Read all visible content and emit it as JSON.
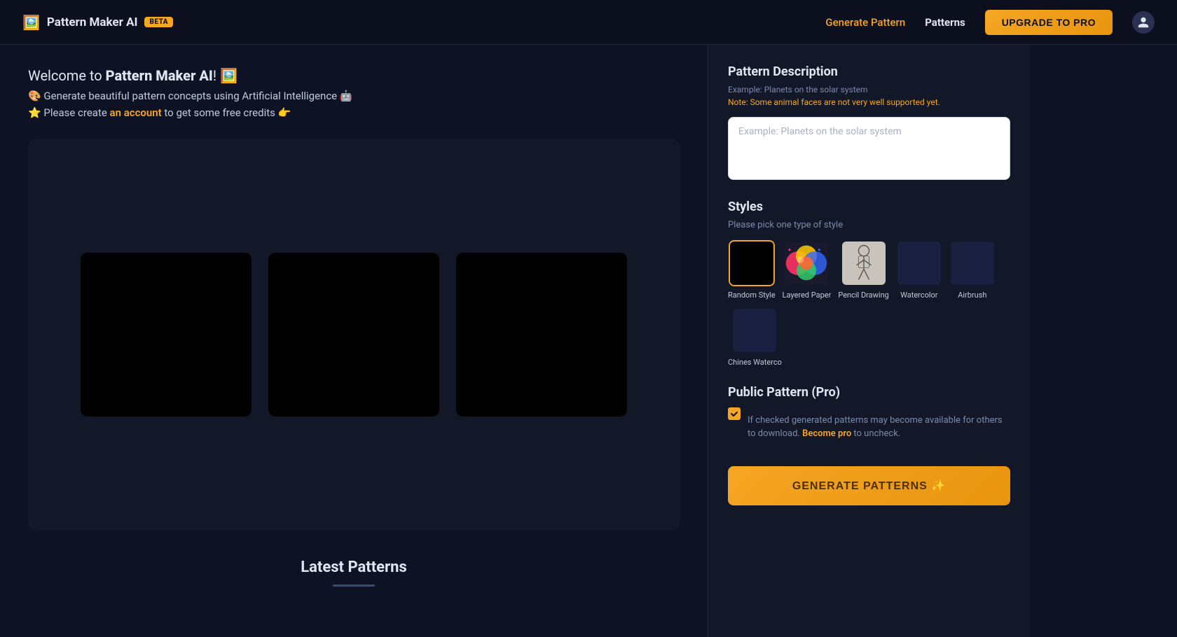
{
  "header": {
    "logo_emoji": "🖼️",
    "logo_title": "Pattern Maker AI",
    "beta_label": "BETA",
    "nav_generate": "Generate Pattern",
    "nav_patterns": "Patterns",
    "upgrade_label": "UPGRADE TO PRO"
  },
  "welcome": {
    "title_prefix": "Welcome to ",
    "title_bold": "Pattern Maker AI",
    "title_suffix": "! 🖼️",
    "subtitle": "🎨 Generate beautiful pattern concepts using Artificial Intelligence 🤖",
    "account_prefix": "⭐ Please create ",
    "account_link_text": "an account",
    "account_suffix": " to get some free credits 👉"
  },
  "right_panel": {
    "description_title": "Pattern Description",
    "description_example": "Example: Planets on the solar system",
    "description_note": "Note: Some animal faces are not very well supported yet.",
    "description_placeholder": "Example: Planets on the solar system",
    "styles_title": "Styles",
    "styles_subtitle": "Please pick one type of style",
    "styles": [
      {
        "id": "random",
        "label": "Random Style",
        "type": "black"
      },
      {
        "id": "layered",
        "label": "Layered Paper",
        "type": "colorful"
      },
      {
        "id": "pencil",
        "label": "Pencil Drawing",
        "type": "pencil"
      },
      {
        "id": "watercolor",
        "label": "Watercolor",
        "type": "none"
      },
      {
        "id": "airbrush",
        "label": "Airbrush",
        "type": "none"
      },
      {
        "id": "chinese",
        "label": "Chines Waterco",
        "type": "none"
      }
    ],
    "public_title": "Public Pattern (Pro)",
    "public_checkbox_text": "If checked generated patterns may become available for others to download.",
    "public_link_text": "Become pro",
    "public_link_suffix": " to uncheck.",
    "generate_label": "GENERATE PATTERNS ✨"
  },
  "latest": {
    "title": "Latest Patterns"
  }
}
